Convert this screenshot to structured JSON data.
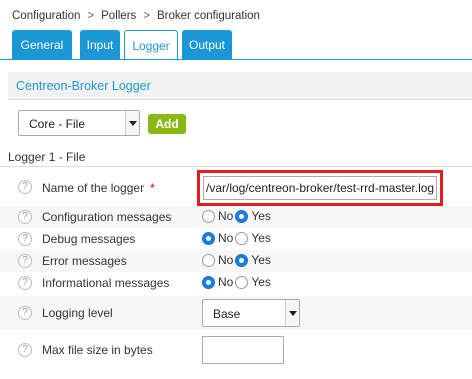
{
  "breadcrumb": [
    "Configuration",
    "Pollers",
    "Broker configuration"
  ],
  "breadcrumb_separator": ">",
  "tabs": [
    {
      "label": "General",
      "active": false
    },
    {
      "label": "Input",
      "active": false
    },
    {
      "label": "Logger",
      "active": true
    },
    {
      "label": "Output",
      "active": false
    }
  ],
  "section_title": "Centreon-Broker Logger",
  "logger_type_select": {
    "value": "Core - File"
  },
  "add_button": "Add",
  "logger_group_label": "Logger 1 - File",
  "help_symbol": "?",
  "fields": {
    "name": {
      "label": "Name of the logger",
      "required_marker": "*",
      "value": "/var/log/centreon-broker/test-rrd-master.log"
    },
    "configuration_messages": {
      "label": "Configuration messages",
      "selected": "Yes"
    },
    "debug_messages": {
      "label": "Debug messages",
      "selected": "No"
    },
    "error_messages": {
      "label": "Error messages",
      "selected": "Yes"
    },
    "informational_messages": {
      "label": "Informational messages",
      "selected": "No"
    },
    "logging_level": {
      "label": "Logging level",
      "value": "Base"
    },
    "max_file_size": {
      "label": "Max file size in bytes",
      "value": ""
    }
  },
  "radio_options": [
    "No",
    "Yes"
  ],
  "colors": {
    "accent": "#1a98d5",
    "add_button": "#88b917",
    "highlight": "#e02020"
  }
}
